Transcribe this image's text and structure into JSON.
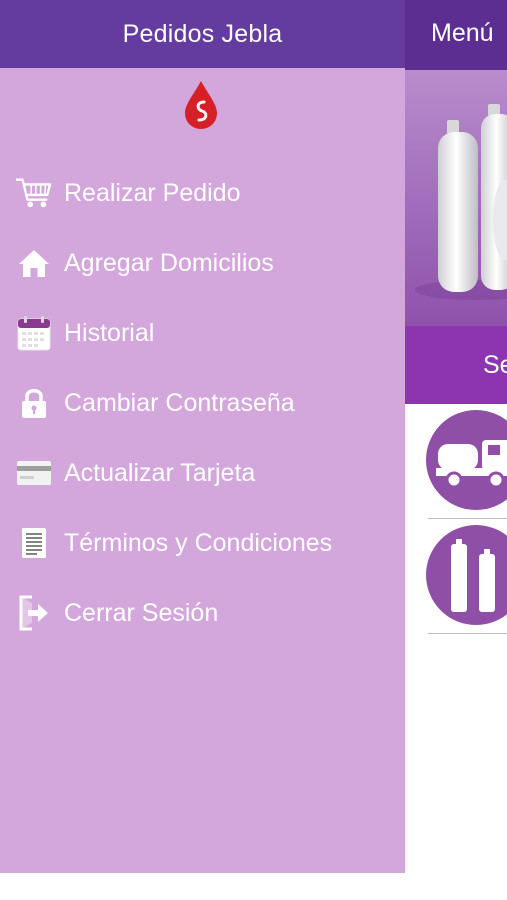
{
  "drawer": {
    "title": "Pedidos Jebla",
    "items": [
      {
        "label": "Realizar Pedido",
        "icon": "cart-icon"
      },
      {
        "label": "Agregar Domicilios",
        "icon": "home-icon"
      },
      {
        "label": "Historial",
        "icon": "calendar-icon"
      },
      {
        "label": "Cambiar Contraseña",
        "icon": "lock-icon"
      },
      {
        "label": "Actualizar Tarjeta",
        "icon": "credit-card-icon"
      },
      {
        "label": "Términos y Condiciones",
        "icon": "document-icon"
      },
      {
        "label": "Cerrar Sesión",
        "icon": "logout-icon"
      }
    ]
  },
  "main": {
    "title": "Menú",
    "section_title": "Se",
    "services": [
      {
        "icon": "truck-icon"
      },
      {
        "icon": "gas-cylinder-icon"
      }
    ]
  },
  "colors": {
    "drawer_header": "#643b9e",
    "drawer_background": "#d3a6dc",
    "main_header": "#5c2e92",
    "section_bar": "#8d35b1",
    "service_circle": "#8f4fa7",
    "logo_drop": "#d61f26"
  }
}
